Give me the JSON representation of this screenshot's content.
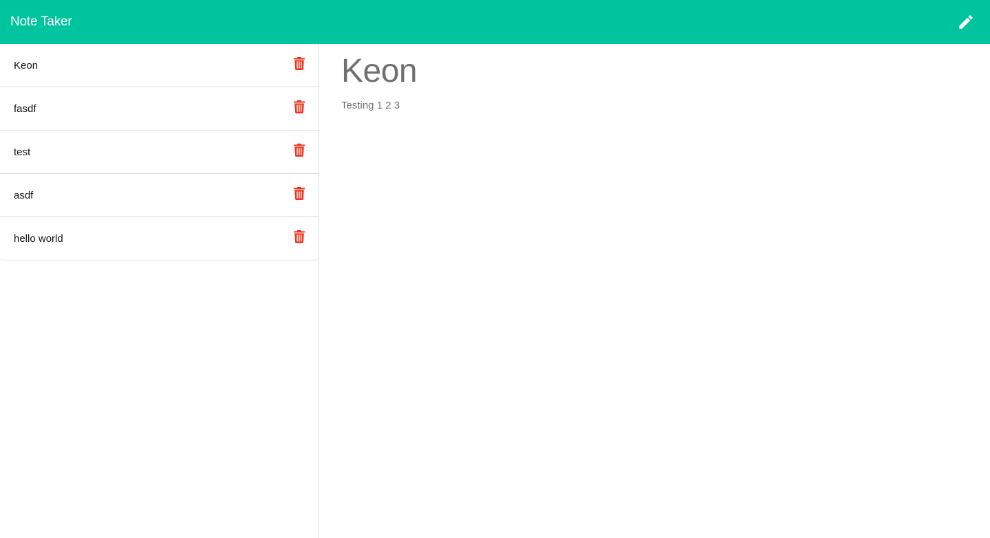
{
  "app": {
    "title": "Note Taker"
  },
  "header": {
    "brand": "Note Taker",
    "new_note_icon": "pencil-icon",
    "accent_color": "#00c49e"
  },
  "notes": [
    {
      "title": "Keon",
      "delete_icon": "trash-icon"
    },
    {
      "title": "fasdf",
      "delete_icon": "trash-icon"
    },
    {
      "title": "test",
      "delete_icon": "trash-icon"
    },
    {
      "title": "asdf",
      "delete_icon": "trash-icon"
    },
    {
      "title": "hello world",
      "delete_icon": "trash-icon"
    }
  ],
  "active_note": {
    "title": "Keon",
    "text": "Testing 1 2 3"
  },
  "colors": {
    "delete": "#f0341d",
    "divider": "#dcdcdc"
  }
}
